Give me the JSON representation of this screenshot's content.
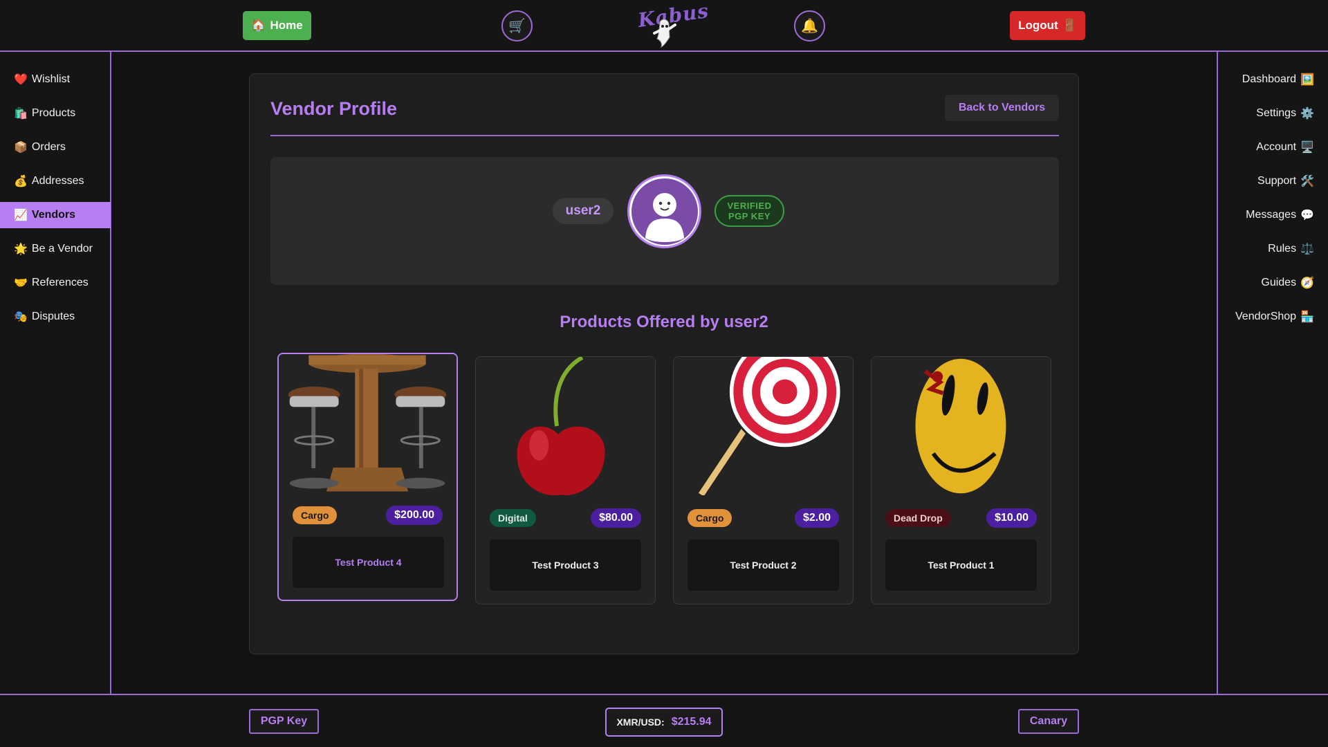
{
  "topbar": {
    "home": {
      "icon": "🏠",
      "label": "Home"
    },
    "cart_icon": "🛒",
    "bell_icon": "🔔",
    "logo_text": "Kabus",
    "logout": {
      "label": "Logout",
      "icon": "🚪"
    }
  },
  "left_sidebar": {
    "items": [
      {
        "icon": "❤️",
        "label": "Wishlist"
      },
      {
        "icon": "🛍️",
        "label": "Products"
      },
      {
        "icon": "📦",
        "label": "Orders"
      },
      {
        "icon": "💰",
        "label": "Addresses"
      },
      {
        "icon": "📈",
        "label": "Vendors",
        "active": true
      },
      {
        "icon": "🌟",
        "label": "Be a Vendor"
      },
      {
        "icon": "🤝",
        "label": "References"
      },
      {
        "icon": "🎭",
        "label": "Disputes"
      }
    ]
  },
  "right_sidebar": {
    "items": [
      {
        "label": "Dashboard",
        "icon": "🖼️"
      },
      {
        "label": "Settings",
        "icon": "⚙️"
      },
      {
        "label": "Account",
        "icon": "🖥️"
      },
      {
        "label": "Support",
        "icon": "🛠️"
      },
      {
        "label": "Messages",
        "icon": "💬"
      },
      {
        "label": "Rules",
        "icon": "⚖️"
      },
      {
        "label": "Guides",
        "icon": "🧭"
      },
      {
        "label": "VendorShop",
        "icon": "🏪"
      }
    ]
  },
  "main": {
    "title": "Vendor Profile",
    "back_button": "Back to Vendors",
    "username": "user2",
    "verified_line1": "VERIFIED",
    "verified_line2": "PGP KEY",
    "products_heading": "Products Offered by user2",
    "products": [
      {
        "name": "Test Product 4",
        "tag": "Cargo",
        "price": "$200.00",
        "image": "bar-table-with-stools"
      },
      {
        "name": "Test Product 3",
        "tag": "Digital",
        "price": "$80.00",
        "image": "cherry"
      },
      {
        "name": "Test Product 2",
        "tag": "Cargo",
        "price": "$2.00",
        "image": "lollipop"
      },
      {
        "name": "Test Product 1",
        "tag": "Dead Drop",
        "price": "$10.00",
        "image": "smiley-face"
      }
    ]
  },
  "footer": {
    "pgp_key": "PGP Key",
    "rate_label": "XMR/USD:",
    "rate_value": "$215.94",
    "canary": "Canary"
  }
}
